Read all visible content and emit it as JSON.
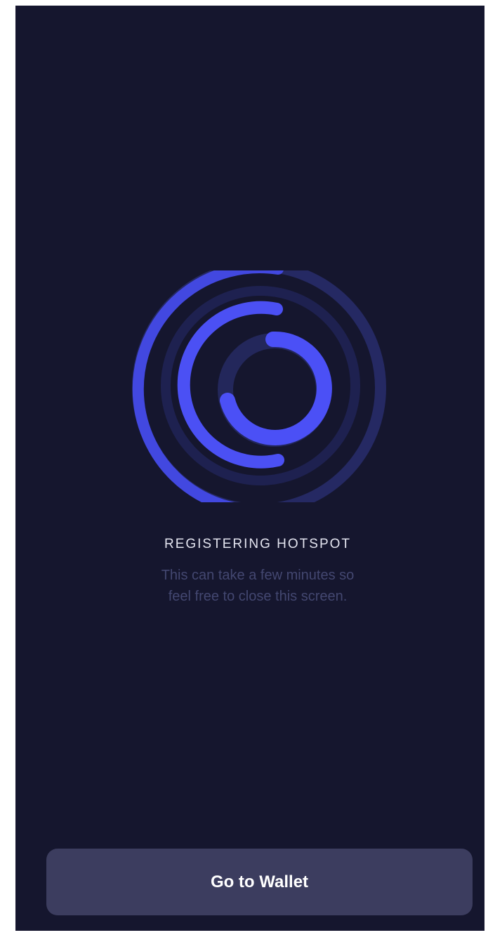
{
  "status": {
    "title": "REGISTERING HOTSPOT",
    "subtitle_line1": "This can take a few minutes so",
    "subtitle_line2": "feel free to close this screen."
  },
  "actions": {
    "go_to_wallet_label": "Go to Wallet"
  },
  "colors": {
    "background": "#15162e",
    "accent": "#4b4ff5",
    "ring_track": "#1f2250",
    "button_bg": "#3c3d5f",
    "title_text": "#e4e5f0",
    "subtitle_text": "#434770"
  },
  "icons": {
    "loader": "concentric-rings-spinner-icon"
  }
}
